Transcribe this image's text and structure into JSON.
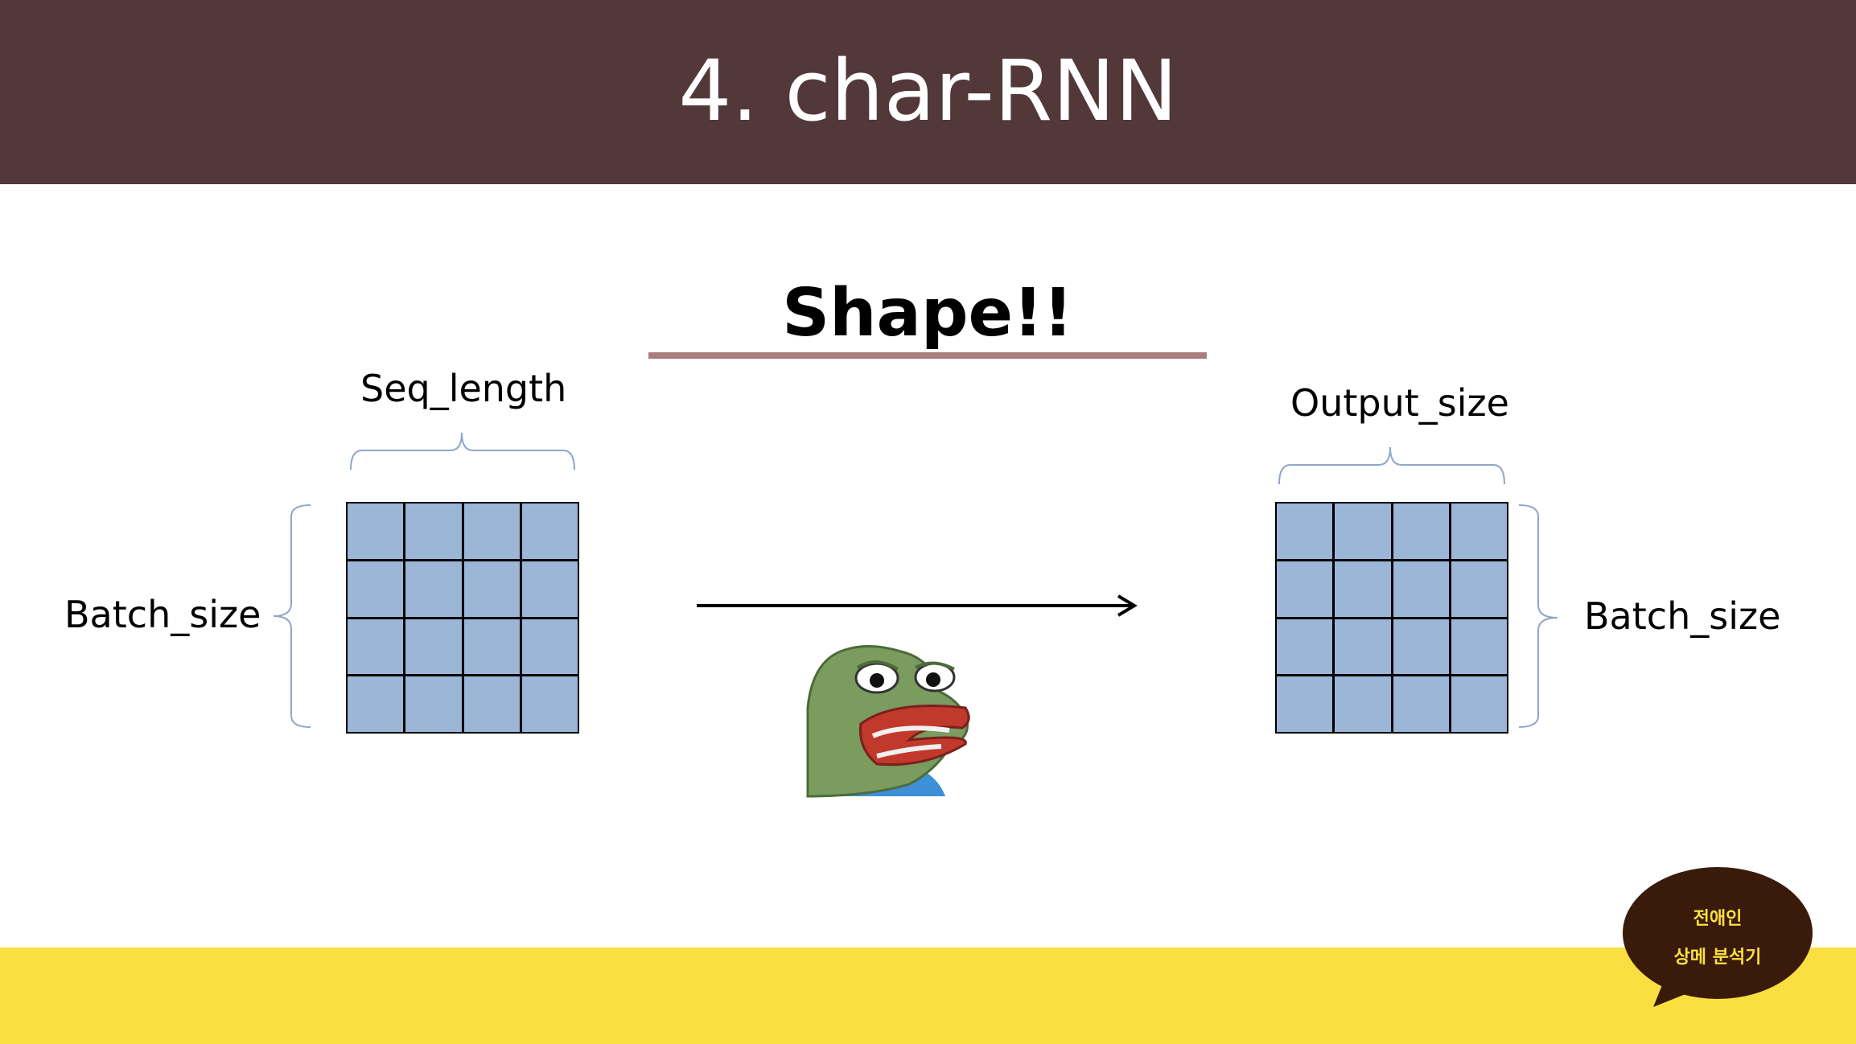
{
  "slide": {
    "title": "4. char-RNN",
    "subtitle": "Shape!!"
  },
  "input_matrix": {
    "top_label": "Seq_length",
    "side_label": "Batch_size",
    "rows": 4,
    "cols": 4
  },
  "output_matrix": {
    "top_label": "Output_size",
    "side_label": "Batch_size",
    "rows": 4,
    "cols": 4
  },
  "badge": {
    "line1": "전애인",
    "line2": "상메 분석기"
  },
  "colors": {
    "header_bg": "#533839",
    "footer_bg": "#f9e040",
    "cell_fill": "#9bb6d6",
    "accent_line": "#a97c7e",
    "brace": "#8fa7c8"
  },
  "icons": {
    "arrow": "right-arrow-icon",
    "meme": "frog-face-illustration"
  }
}
